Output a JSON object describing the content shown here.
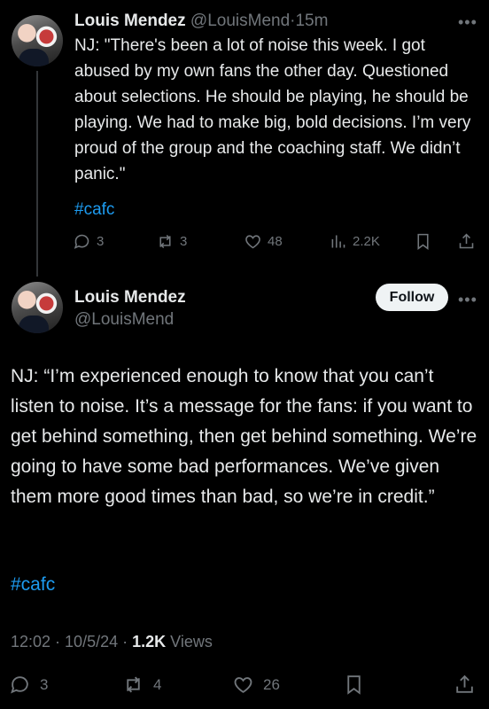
{
  "tweet1": {
    "name": "Louis Mendez",
    "handle": "@LouisMend",
    "separator": "·",
    "time": "15m",
    "text": "NJ: \"There's been a lot of noise this week. I got abused by my own fans the other day. Questioned about selections. He should be playing, he should be playing. We had to make big, bold decisions. I’m very proud of the group and the coaching staff. We didn’t panic.\"",
    "hashtag": "#cafc",
    "actions": {
      "replies": "3",
      "reposts": "3",
      "likes": "48",
      "views": "2.2K"
    }
  },
  "tweet2": {
    "name": "Louis Mendez",
    "handle": "@LouisMend",
    "follow_label": "Follow",
    "text": "NJ: “I’m experienced enough to know that you can’t listen to noise. It’s a message for the fans: if you want to get behind something, then get behind something. We’re going to have some bad performances. We’ve given them more good times than bad, so we’re in credit.”",
    "hashtag": "#cafc",
    "meta": {
      "time": "12:02",
      "separator1": " · ",
      "date": "10/5/24",
      "separator2": " · ",
      "views_count": "1.2K",
      "views_label": " Views"
    },
    "actions": {
      "replies": "3",
      "reposts": "4",
      "likes": "26"
    }
  },
  "more_label": "•••",
  "colors": {
    "background": "#000000",
    "text": "#e7e9ea",
    "secondary": "#71767b",
    "link": "#1d9bf0"
  }
}
